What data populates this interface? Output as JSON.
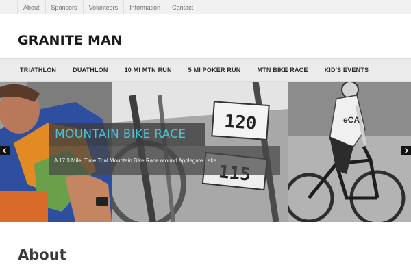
{
  "topbar": {
    "items": [
      {
        "label": "About"
      },
      {
        "label": "Sponsors"
      },
      {
        "label": "Volunteers"
      },
      {
        "label": "Information"
      },
      {
        "label": "Contact"
      }
    ]
  },
  "header": {
    "logo_text": "GRANITE MAN"
  },
  "mainnav": {
    "items": [
      {
        "label": "TRIATHLON"
      },
      {
        "label": "DUATHLON"
      },
      {
        "label": "10 MI MTN RUN"
      },
      {
        "label": "5 MI POKER RUN"
      },
      {
        "label": "MTN BIKE RACE"
      },
      {
        "label": "KID'S EVENTS"
      }
    ]
  },
  "slider": {
    "caption_title": "MOUNTAIN BIKE RACE",
    "caption_desc": "A 17.3 Mile, Time Trial Mountain Bike Race around Applegate Lake.",
    "bib_numbers": [
      "120",
      "115"
    ],
    "prev_icon": "chevron-left-icon",
    "next_icon": "chevron-right-icon",
    "caption_color": "#46c4d8"
  },
  "about": {
    "title": "About"
  }
}
